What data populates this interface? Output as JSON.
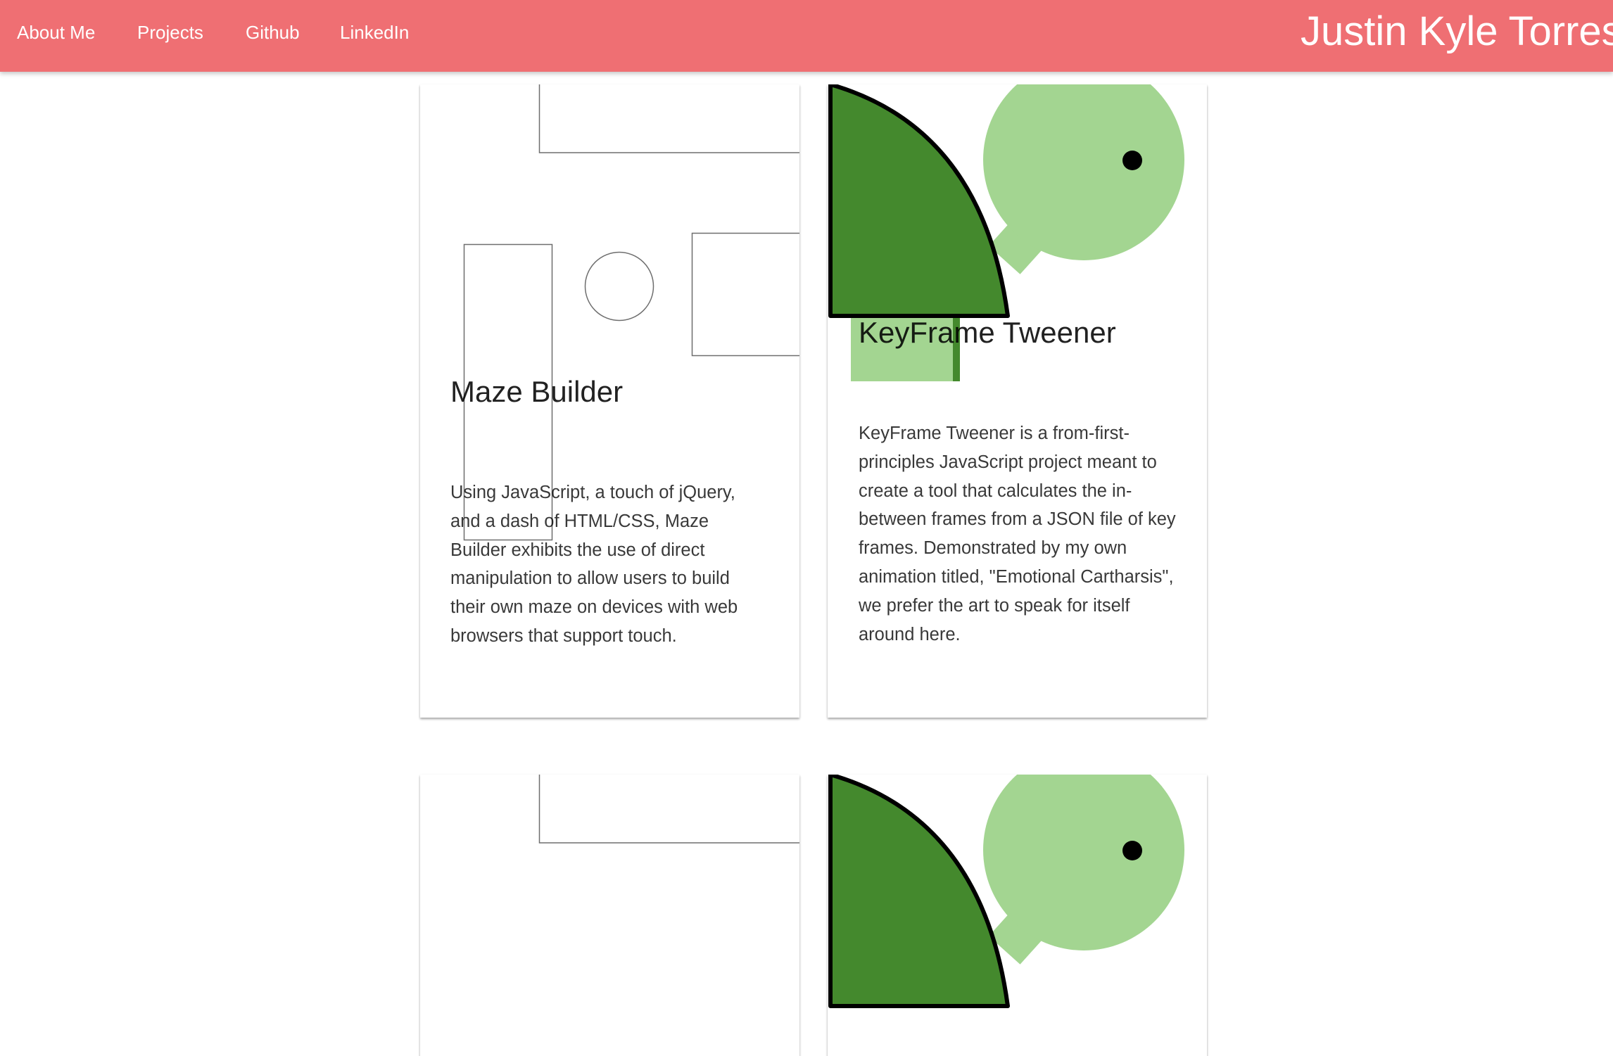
{
  "nav": {
    "links": [
      {
        "label": "About Me"
      },
      {
        "label": "Projects"
      },
      {
        "label": "Github"
      },
      {
        "label": "LinkedIn"
      }
    ],
    "brand": "Justin Kyle Torres",
    "color": "#ef6f73"
  },
  "projects": [
    {
      "title": "Maze Builder",
      "description": "Using JavaScript, a touch of jQuery, and a dash of HTML/CSS, Maze Builder exhibits the use of direct manipulation to allow users to build their own maze on devices with web browsers that support touch."
    },
    {
      "title": "KeyFrame Tweener",
      "description": "KeyFrame Tweener is a from-first-principles JavaScript project meant to create a tool that calculates the in-between frames from a JSON file of key frames. Demonstrated by my own animation titled, \"Emotional Carthar­sis\", we prefer the art to speak for itself around here."
    }
  ],
  "colors": {
    "dark_green": "#44892d",
    "light_green": "#a3d591"
  }
}
